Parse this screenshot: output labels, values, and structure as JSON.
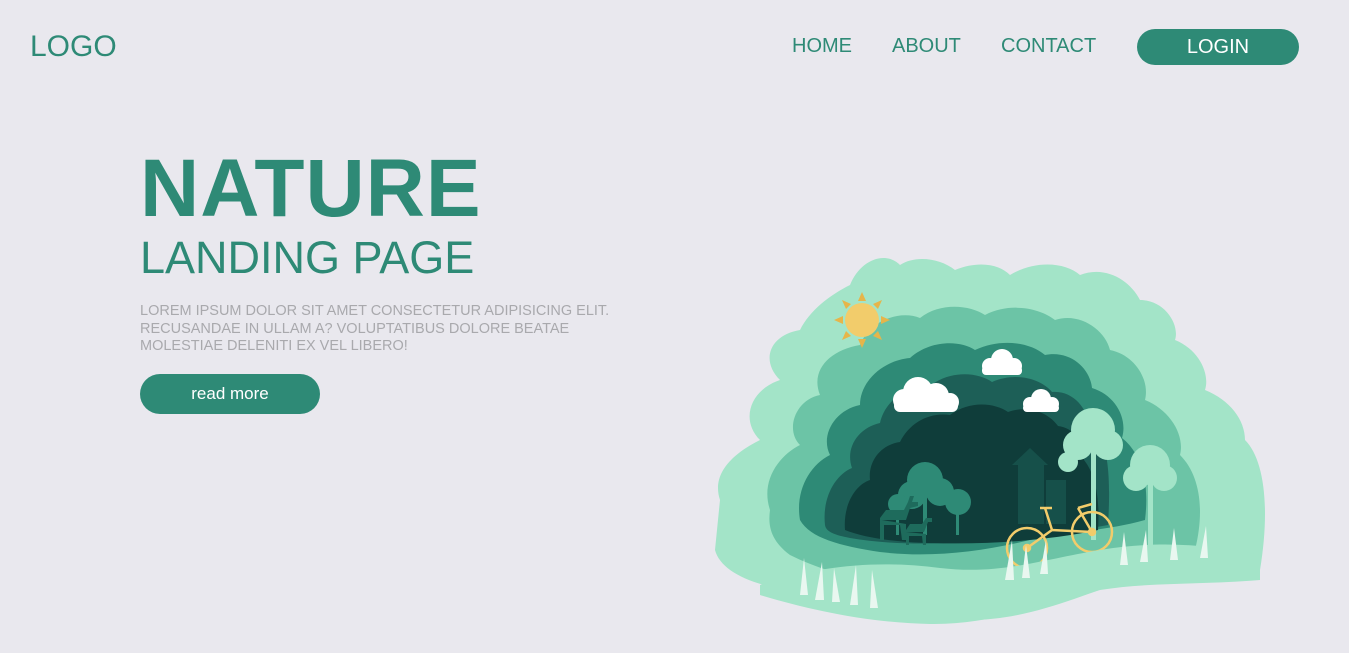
{
  "header": {
    "logo": "LOGO",
    "nav": {
      "home": "HOME",
      "about": "ABOUT",
      "contact": "CONTACT"
    },
    "login": "LOGIN"
  },
  "hero": {
    "title": "NATURE",
    "subtitle": "LANDING PAGE",
    "text": "LOREM IPSUM DOLOR SIT AMET CONSECTETUR ADIPISICING ELIT. RECUSANDAE IN ULLAM A? VOLUPTATIBUS DOLORE BEATAE MOLESTIAE DELENITI EX VEL LIBERO!",
    "button": "read more"
  },
  "illustration": {
    "name": "paper-cut-nature-scene",
    "icons": [
      "sun-icon",
      "cloud-icon",
      "tree-icon",
      "deer-icon",
      "bicycle-icon",
      "building-icon",
      "grass-icon"
    ]
  },
  "colors": {
    "background": "#e9e8ee",
    "primary": "#2e8a76",
    "text_muted": "#a9a9ad",
    "paper_light": "#a3e4c8",
    "paper_mid": "#5fb89a",
    "paper_dark": "#0f3d3a",
    "sun": "#f2cc6b"
  }
}
